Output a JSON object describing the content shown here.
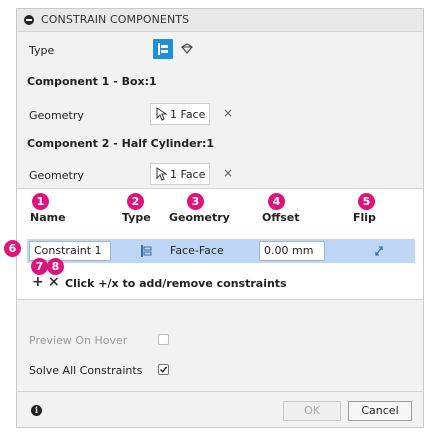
{
  "header": {
    "title": "CONSTRAIN COMPONENTS"
  },
  "type_row": {
    "label": "Type"
  },
  "component1": {
    "heading": "Component 1 - Box:1",
    "geometry_label": "Geometry",
    "selection": "1 Face"
  },
  "component2": {
    "heading": "Component 2 - Half Cylinder:1",
    "geometry_label": "Geometry",
    "selection": "1 Face"
  },
  "table": {
    "headers": [
      "Name",
      "Type",
      "Geometry",
      "Offset",
      "Flip"
    ],
    "badges": [
      "1",
      "2",
      "3",
      "4",
      "5",
      "6",
      "7",
      "8"
    ],
    "row": {
      "name": "Constraint 1",
      "geometry": "Face-Face",
      "offset": "0.00 mm"
    },
    "add_symbol": "+",
    "remove_symbol": "×",
    "hint": "Click +/x to add/remove constraints"
  },
  "options": {
    "preview_on_hover": {
      "label": "Preview On Hover",
      "checked": false,
      "enabled": false
    },
    "solve_all": {
      "label": "Solve All Constraints",
      "checked": true,
      "enabled": true
    }
  },
  "footer": {
    "ok_label": "OK",
    "cancel_label": "Cancel"
  },
  "colors": {
    "accent": "#1f8fd8",
    "badge": "#e0137d",
    "row_highlight": "#bed7f6"
  },
  "icons": [
    "collapse-icon",
    "mate-type-icon",
    "flip-type-icon",
    "cursor-select-icon",
    "clear-icon",
    "plus-icon",
    "remove-icon",
    "flip-icon",
    "info-icon",
    "checkbox-icon"
  ]
}
